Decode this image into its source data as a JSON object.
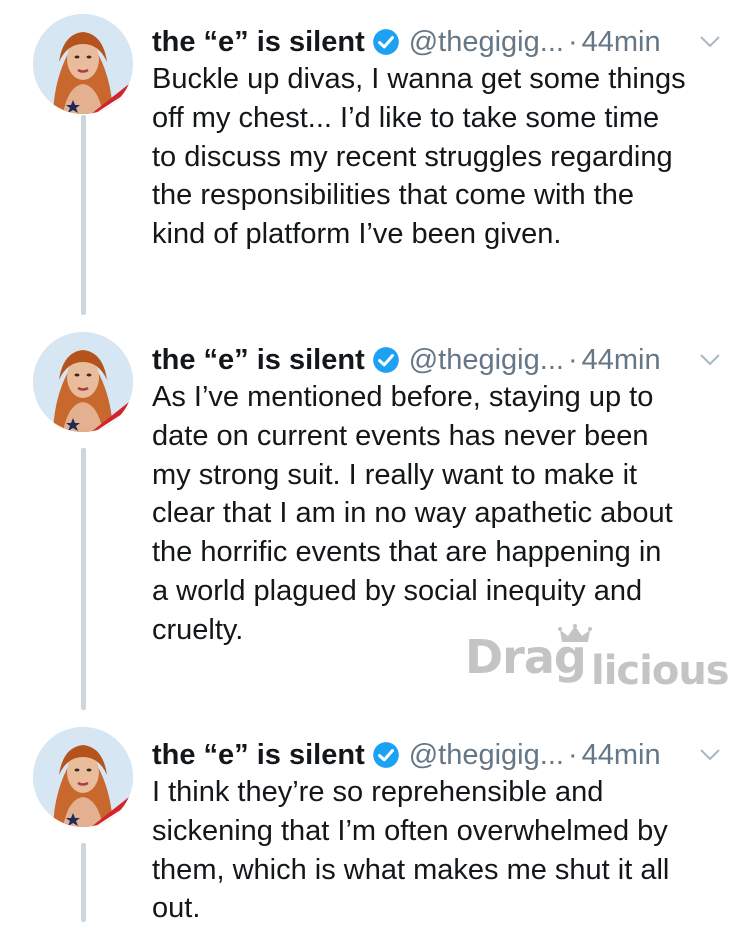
{
  "tweets": [
    {
      "name": "the “e” is silent",
      "handle": "@thegigig...",
      "separator": "·",
      "time": "44min",
      "text": "Buckle up divas, I wanna get some things\noff my chest... I’d like to take some time\nto discuss my recent struggles regarding\nthe responsibilities that come with the\nkind of platform I’ve been given."
    },
    {
      "name": "the “e” is silent",
      "handle": "@thegigig...",
      "separator": "·",
      "time": "44min",
      "text": "As I’ve mentioned before, staying up to\ndate on current events has never been\nmy strong suit. I really want to make it\nclear that I am in no way apathetic about\nthe horrific events that are happening in\na world plagued by social inequity and\ncruelty."
    },
    {
      "name": "the “e” is silent",
      "handle": "@thegigig...",
      "separator": "·",
      "time": "44min",
      "text": "I think they’re so reprehensible and\nsickening that I’m often overwhelmed by\nthem, which is what makes me shut it all\nout."
    }
  ],
  "watermark": {
    "part1": "Drag",
    "part2": "licious"
  },
  "icons": {
    "verified": "verified-badge-icon",
    "chevron": "chevron-down-icon",
    "avatar": "avatar"
  },
  "colors": {
    "verified": "#1da1f2",
    "muted": "#657786",
    "thread_line": "#ccd6dd",
    "text": "#14171a"
  }
}
